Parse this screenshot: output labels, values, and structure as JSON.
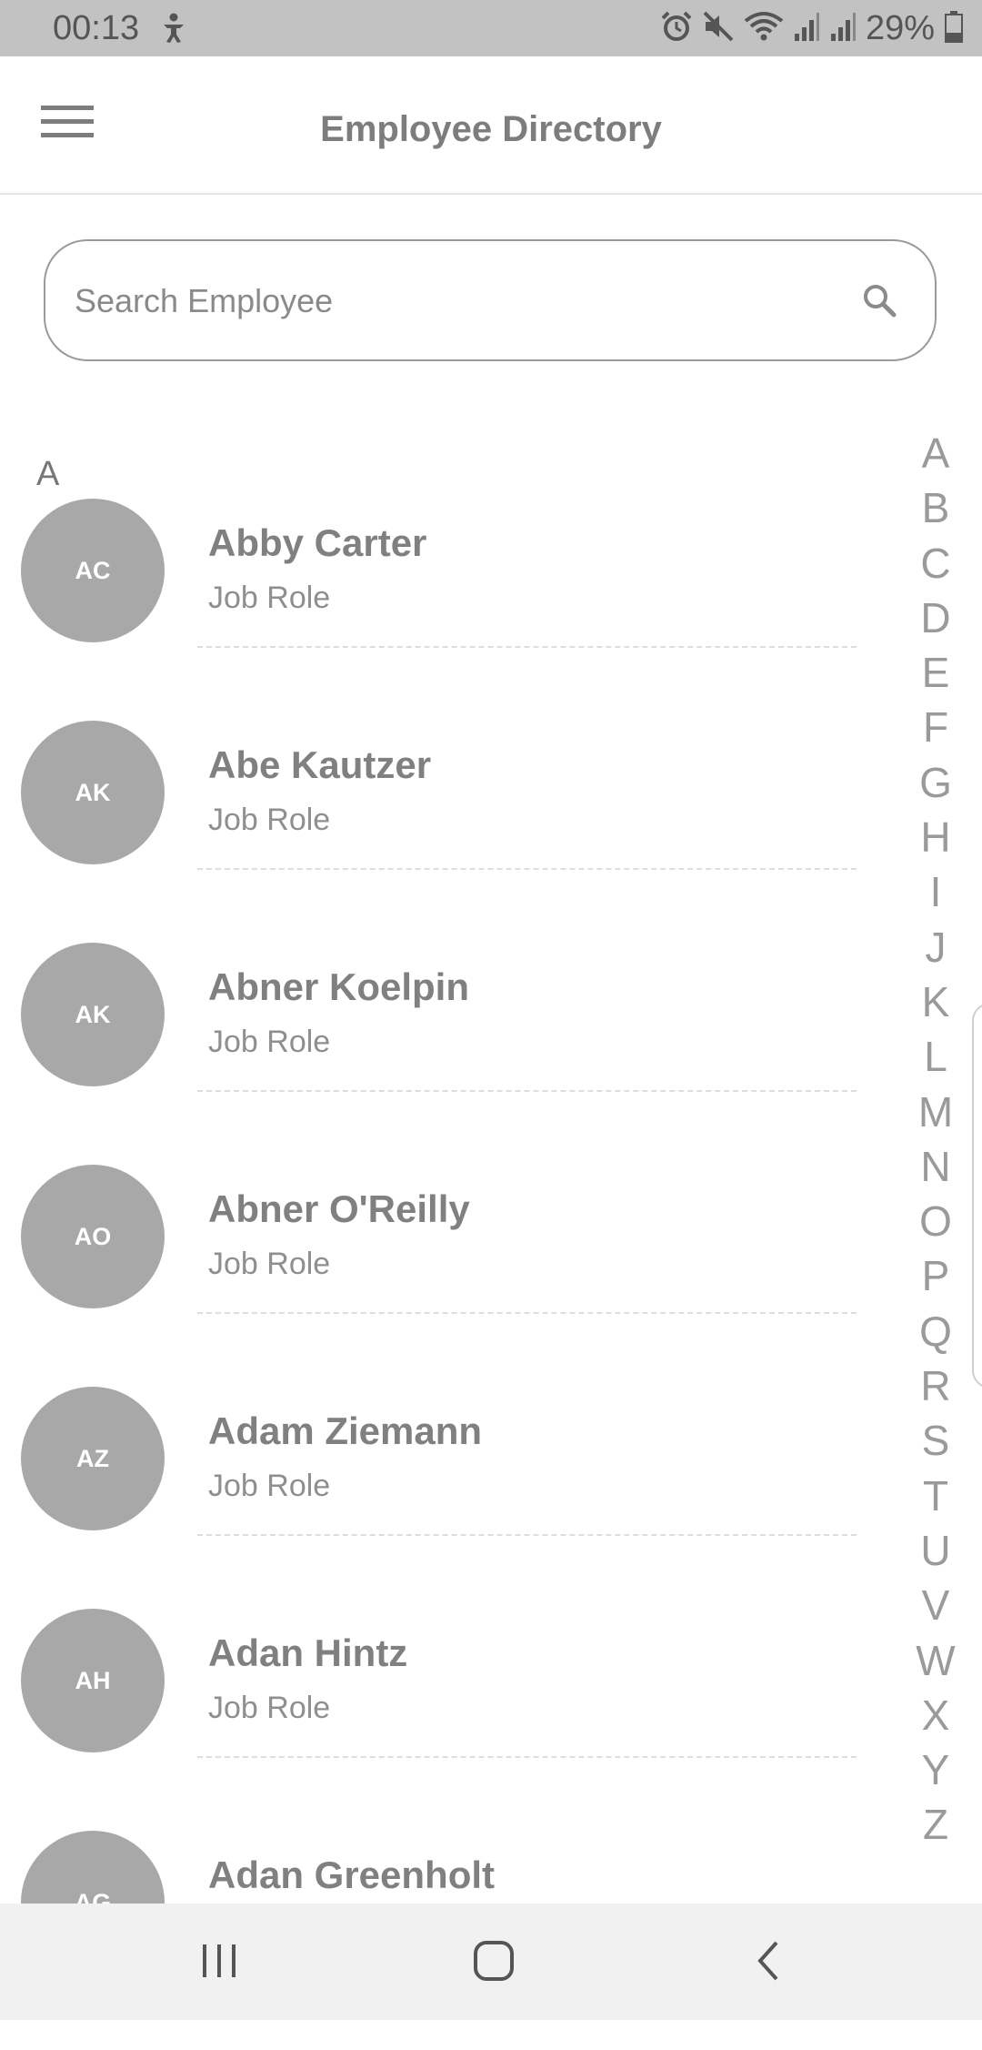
{
  "status_bar": {
    "time": "00:13",
    "battery": "29%",
    "icons": [
      "accessibility-icon",
      "alarm-icon",
      "mute-icon",
      "wifi-icon",
      "signal-icon",
      "signal-icon",
      "battery-icon"
    ]
  },
  "app_bar": {
    "title": "Employee Directory",
    "menu_icon": "hamburger-menu-icon"
  },
  "search": {
    "placeholder": "Search Employee",
    "value": "",
    "icon": "search-icon"
  },
  "section": {
    "letter": "A"
  },
  "employees": [
    {
      "initials": "AC",
      "name": "Abby Carter",
      "role": "Job Role"
    },
    {
      "initials": "AK",
      "name": "Abe Kautzer",
      "role": "Job Role"
    },
    {
      "initials": "AK",
      "name": "Abner Koelpin",
      "role": "Job Role"
    },
    {
      "initials": "AO",
      "name": "Abner O'Reilly",
      "role": "Job Role"
    },
    {
      "initials": "AZ",
      "name": "Adam Ziemann",
      "role": "Job Role"
    },
    {
      "initials": "AH",
      "name": "Adan Hintz",
      "role": "Job Role"
    },
    {
      "initials": "AG",
      "name": "Adan Greenholt",
      "role": ""
    }
  ],
  "alphabet": [
    "A",
    "B",
    "C",
    "D",
    "E",
    "F",
    "G",
    "H",
    "I",
    "J",
    "K",
    "L",
    "M",
    "N",
    "O",
    "P",
    "Q",
    "R",
    "S",
    "T",
    "U",
    "V",
    "W",
    "X",
    "Y",
    "Z"
  ],
  "nav_bar": {
    "recents_icon": "recents-icon",
    "home_icon": "home-icon",
    "back_icon": "back-icon"
  },
  "colors": {
    "status_bar_bg": "#c2c2c2",
    "avatar_bg": "#a8a8a8",
    "nav_bar_bg": "#f1f1f1"
  }
}
